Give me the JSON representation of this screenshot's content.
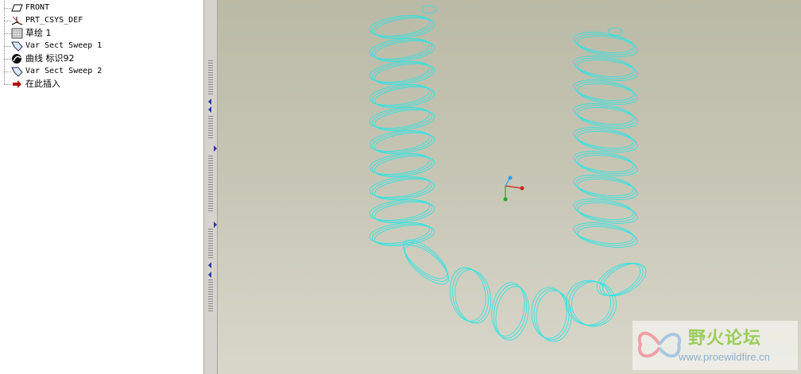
{
  "model_tree": {
    "items": [
      {
        "label": "FRONT",
        "icon": "datum-plane-icon"
      },
      {
        "label": "PRT_CSYS_DEF",
        "icon": "coordinate-system-icon"
      },
      {
        "label": "草绘 1",
        "icon": "sketch-icon"
      },
      {
        "label": "Var Sect Sweep 1",
        "icon": "var-sect-sweep-icon"
      },
      {
        "label": "曲线 标识92",
        "icon": "curve-icon"
      },
      {
        "label": "Var Sect Sweep 2",
        "icon": "var-sect-sweep-icon"
      },
      {
        "label": "在此插入",
        "icon": "insert-here-arrow-icon"
      }
    ]
  },
  "viewport": {
    "model_color": "#25e6e6",
    "csys_colors": {
      "x": "#cc2020",
      "y": "#20aa20",
      "z": "#20a0ff"
    }
  },
  "watermark": {
    "title": "野火论坛",
    "url": "www.proewildfire.cn"
  }
}
